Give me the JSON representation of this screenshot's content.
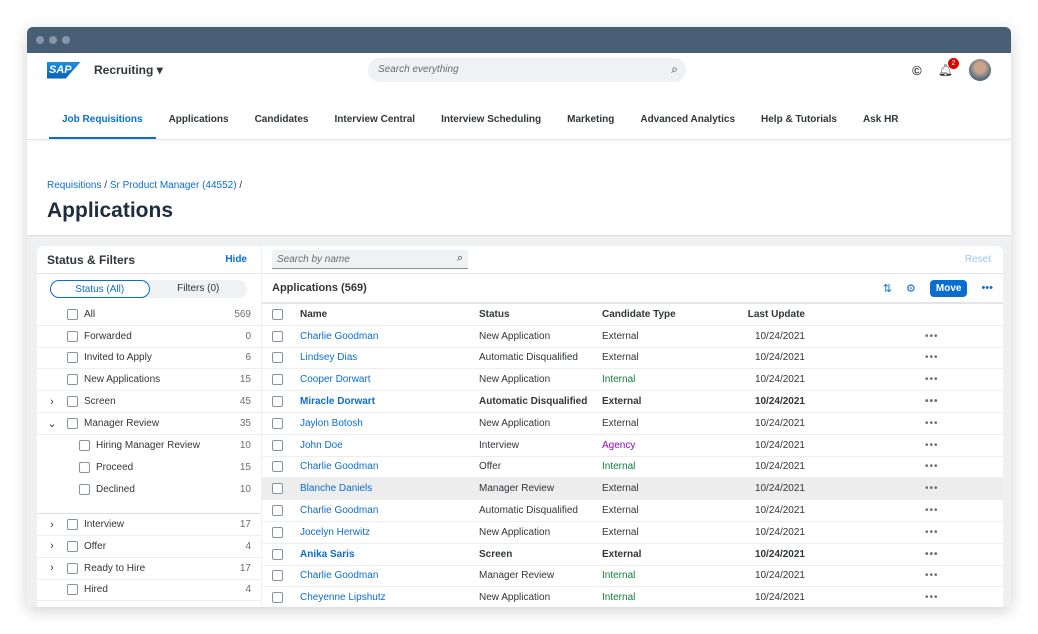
{
  "shell": {
    "logo": "SAP",
    "app": "Recruiting",
    "search_placeholder": "Search everything",
    "notifications": "2"
  },
  "tabs": [
    "Job Requisitions",
    "Applications",
    "Candidates",
    "Interview Central",
    "Interview Scheduling",
    "Marketing",
    "Advanced Analytics",
    "Help & Tutorials",
    "Ask HR"
  ],
  "breadcrumb": [
    "Requisitions",
    "Sr Product Manager (44552)"
  ],
  "page_title": "Applications",
  "filters": {
    "title": "Status & Filters",
    "hide": "Hide",
    "seg": [
      "Status (All)",
      "Filters (0)"
    ],
    "items": [
      {
        "label": "All",
        "count": "569",
        "chev": ""
      },
      {
        "label": "Forwarded",
        "count": "0",
        "chev": ""
      },
      {
        "label": "Invited to Apply",
        "count": "6",
        "chev": ""
      },
      {
        "label": "New Applications",
        "count": "15",
        "chev": ""
      },
      {
        "label": "Screen",
        "count": "45",
        "chev": "right"
      },
      {
        "label": "Manager Review",
        "count": "35",
        "chev": "down",
        "children": [
          {
            "label": "Hiring Manager Review",
            "count": "10"
          },
          {
            "label": "Proceed",
            "count": "15"
          },
          {
            "label": "Declined",
            "count": "10"
          }
        ]
      },
      {
        "label": "Interview",
        "count": "17",
        "chev": "right"
      },
      {
        "label": "Offer",
        "count": "4",
        "chev": "right"
      },
      {
        "label": "Ready to Hire",
        "count": "17",
        "chev": "right"
      },
      {
        "label": "Hired",
        "count": "4",
        "chev": ""
      }
    ]
  },
  "table": {
    "search_placeholder": "Search by name",
    "reset": "Reset",
    "title": "Applications (569)",
    "move": "Move",
    "columns": [
      "Name",
      "Status",
      "Candidate Type",
      "Last Update"
    ],
    "type_colors": {
      "External": "#32363a",
      "Internal": "#107e3e",
      "Agency": "#a100c2"
    },
    "rows": [
      {
        "name": "Charlie Goodman",
        "status": "New Application",
        "type": "External",
        "date": "10/24/2021"
      },
      {
        "name": "Lindsey Dias",
        "status": "Automatic Disqualified",
        "type": "External",
        "date": "10/24/2021"
      },
      {
        "name": "Cooper Dorwart",
        "status": "New Application",
        "type": "Internal",
        "date": "10/24/2021"
      },
      {
        "name": "Miracle Dorwart",
        "status": "Automatic Disqualified",
        "type": "External",
        "date": "10/24/2021",
        "bold": true
      },
      {
        "name": "Jaylon Botosh",
        "status": "New Application",
        "type": "External",
        "date": "10/24/2021"
      },
      {
        "name": "John Doe",
        "status": "Interview",
        "type": "Agency",
        "date": "10/24/2021"
      },
      {
        "name": "Charlie Goodman",
        "status": "Offer",
        "type": "Internal",
        "date": "10/24/2021"
      },
      {
        "name": "Blanche Daniels",
        "status": "Manager Review",
        "type": "External",
        "date": "10/24/2021",
        "selected": true
      },
      {
        "name": "Charlie Goodman",
        "status": "Automatic Disqualified",
        "type": "External",
        "date": "10/24/2021"
      },
      {
        "name": "Jocelyn Herwitz",
        "status": "New Application",
        "type": "External",
        "date": "10/24/2021"
      },
      {
        "name": "Anika Saris",
        "status": "Screen",
        "type": "External",
        "date": "10/24/2021",
        "bold": true
      },
      {
        "name": "Charlie Goodman",
        "status": "Manager Review",
        "type": "Internal",
        "date": "10/24/2021"
      },
      {
        "name": "Cheyenne Lipshutz",
        "status": "New Application",
        "type": "Internal",
        "date": "10/24/2021"
      }
    ]
  }
}
